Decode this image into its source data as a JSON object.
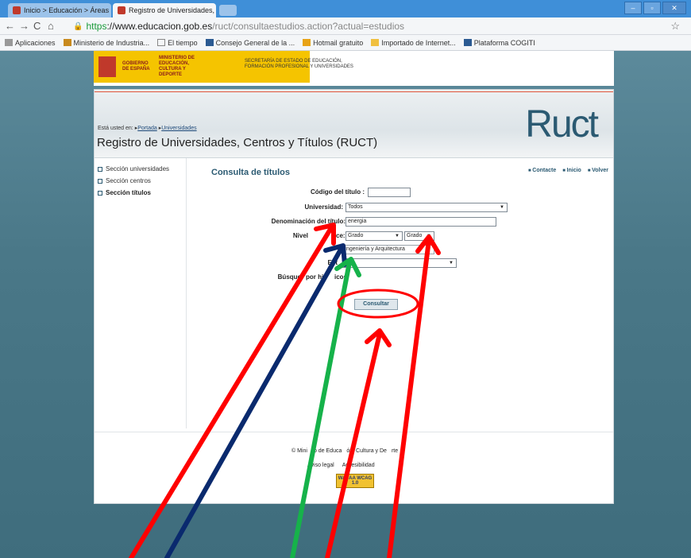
{
  "browser": {
    "tabs": [
      {
        "label": "Inicio > Educación > Áreas d"
      },
      {
        "label": "Registro de Universidades, C"
      }
    ],
    "url": {
      "scheme": "https",
      "host": "://www.educacion.gob.es",
      "path": "/ruct/consultaestudios.action?actual=estudios"
    },
    "bookmarks": [
      "Aplicaciones",
      "Ministerio de Industria...",
      "El tiempo",
      "Consejo General de la ...",
      "Hotmail gratuito",
      "Importado de Internet...",
      "Plataforma COGITI"
    ]
  },
  "header": {
    "gov_logo_text": "GOBIERNO DE ESPAÑA",
    "ministry_text": "MINISTERIO DE EDUCACIÓN, CULTURA Y DEPORTE",
    "secretary_text": "SECRETARÍA DE ESTADO DE EDUCACIÓN, FORMACIÓN PROFESIONAL Y UNIVERSIDADES",
    "breadcrumb_prefix": "Está usted en:",
    "breadcrumb_items": [
      "Portada",
      "Universidades"
    ],
    "page_title": "Registro de Universidades, Centros y Títulos (RUCT)",
    "logo": "Ruct"
  },
  "sidebar": {
    "items": [
      {
        "label": "Sección universidades"
      },
      {
        "label": "Sección centros"
      },
      {
        "label": "Sección títulos"
      }
    ]
  },
  "main": {
    "title": "Consulta de títulos",
    "links": [
      "Contacte",
      "Inicio",
      "Volver"
    ],
    "form": {
      "codigo_label": "Código del título :",
      "codigo_value": "",
      "universidad_label": "Universidad:",
      "universidad_value": "Todos",
      "denominacion_label": "Denominación del título:",
      "denominacion_value": "energia",
      "nivel_label_visible": "Nivel",
      "nivel_label_tail": "ce:",
      "nivel_value": "Grado",
      "nivel_sub_value": "Grado",
      "rama_label_visible": "R",
      "rama_value": "Ingeniería y Arquitectura",
      "estado_label_visible": "Est",
      "estado_value": "To",
      "busqueda_label_visible": "Búsque",
      "busqueda_label_tail": "por his",
      "busqueda_label_end": "icos:",
      "submit_label": "Consultar"
    }
  },
  "footer": {
    "copyright_a": "© Mini",
    "copyright_b": "o de Educa",
    "copyright_c": "ón, Cultura y De",
    "copyright_d": "rte",
    "links": [
      "Aviso legal",
      "Accesibilidad"
    ],
    "badge": "WAI-AA WCAG 1.0"
  },
  "annotation_colors": {
    "red": "#ff0000",
    "navy": "#0a2a6e",
    "green": "#16b24a"
  }
}
